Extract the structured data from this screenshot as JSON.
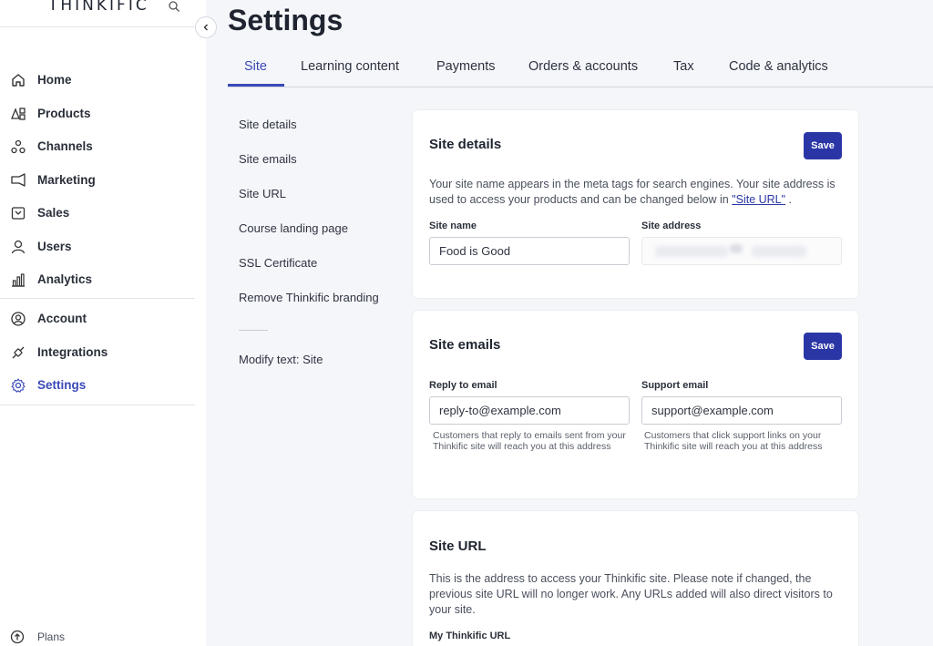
{
  "app": {
    "logo": "THINKIFIC"
  },
  "sidebar": {
    "items": [
      {
        "label": "Home",
        "icon": "home-icon"
      },
      {
        "label": "Products",
        "icon": "products-icon"
      },
      {
        "label": "Channels",
        "icon": "channels-icon"
      },
      {
        "label": "Marketing",
        "icon": "marketing-icon"
      },
      {
        "label": "Sales",
        "icon": "sales-icon"
      },
      {
        "label": "Users",
        "icon": "user-icon"
      },
      {
        "label": "Analytics",
        "icon": "analytics-icon"
      },
      {
        "label": "Account",
        "icon": "account-icon"
      },
      {
        "label": "Integrations",
        "icon": "integrations-icon"
      },
      {
        "label": "Settings",
        "icon": "gear-icon",
        "active": true
      }
    ],
    "plans_label": "Plans",
    "active_color": "#3a4ab8"
  },
  "header": {
    "title": "Settings",
    "tabs": [
      {
        "label": "Site",
        "active": true
      },
      {
        "label": "Learning content"
      },
      {
        "label": "Payments"
      },
      {
        "label": "Orders & accounts"
      },
      {
        "label": "Tax"
      },
      {
        "label": "Code & analytics"
      }
    ]
  },
  "subnav": {
    "items": [
      "Site details",
      "Site emails",
      "Site URL",
      "Course landing page",
      "SSL Certificate",
      "Remove Thinkific branding"
    ],
    "extra": "Modify text: Site"
  },
  "cards": {
    "site_details": {
      "title": "Site details",
      "save_label": "Save",
      "description_pre": "Your site name appears in the meta tags for search engines. Your site address is used to access your products and can be changed below in ",
      "description_link": "\"Site URL\"",
      "description_post": " .",
      "site_name_label": "Site name",
      "site_name_value": "Food is Good",
      "site_address_label": "Site address"
    },
    "site_emails": {
      "title": "Site emails",
      "save_label": "Save",
      "reply_label": "Reply to email",
      "reply_value": "reply-to@example.com",
      "reply_help": "Customers that reply to emails sent from your Thinkific site will reach you at this address",
      "support_label": "Support email",
      "support_value": "support@example.com",
      "support_help": "Customers that click support links on your Thinkific site will reach you at this address"
    },
    "site_url": {
      "title": "Site URL",
      "description": "This is the address to access your Thinkific site. Please note if changed, the previous site URL will no longer work. Any URLs added will also direct visitors to your site.",
      "my_url_label": "My Thinkific URL"
    }
  },
  "colors": {
    "primary": "#2a36a6",
    "background": "#f5f6fa"
  }
}
